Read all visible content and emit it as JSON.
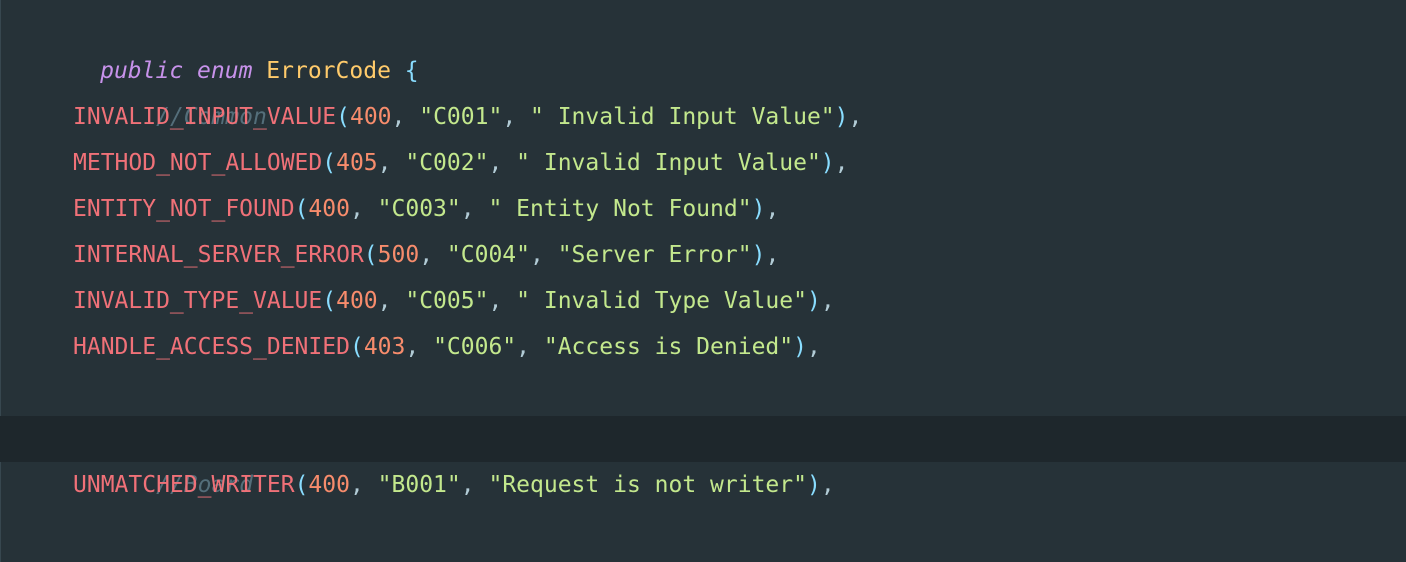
{
  "editor": {
    "declaration": {
      "modifier": "public",
      "keyword": "enum",
      "name": "ErrorCode",
      "open_brace": "{"
    },
    "comment_common": "//Common",
    "comment_board": "//Board",
    "entries": [
      {
        "name": "INVALID_INPUT_VALUE",
        "status": "400",
        "code": "\"C001\"",
        "message": "\" Invalid Input Value\""
      },
      {
        "name": "METHOD_NOT_ALLOWED",
        "status": "405",
        "code": "\"C002\"",
        "message": "\" Invalid Input Value\""
      },
      {
        "name": "ENTITY_NOT_FOUND",
        "status": "400",
        "code": "\"C003\"",
        "message": "\" Entity Not Found\""
      },
      {
        "name": "INTERNAL_SERVER_ERROR",
        "status": "500",
        "code": "\"C004\"",
        "message": "\"Server Error\""
      },
      {
        "name": "INVALID_TYPE_VALUE",
        "status": "400",
        "code": "\"C005\"",
        "message": "\" Invalid Type Value\""
      },
      {
        "name": "HANDLE_ACCESS_DENIED",
        "status": "403",
        "code": "\"C006\"",
        "message": "\"Access is Denied\""
      },
      {
        "name": "UNMATCHED_WRITER",
        "status": "400",
        "code": "\"B001\"",
        "message": "\"Request is not writer\""
      }
    ],
    "colors": {
      "background": "#263238",
      "active_line": "#1e272c",
      "keyword": "#c792ea",
      "type": "#ffcb6b",
      "constant": "#f07178",
      "number": "#f78c6c",
      "string": "#c3e88d",
      "comment": "#546e7a",
      "punctuation": "#89ddff"
    }
  }
}
